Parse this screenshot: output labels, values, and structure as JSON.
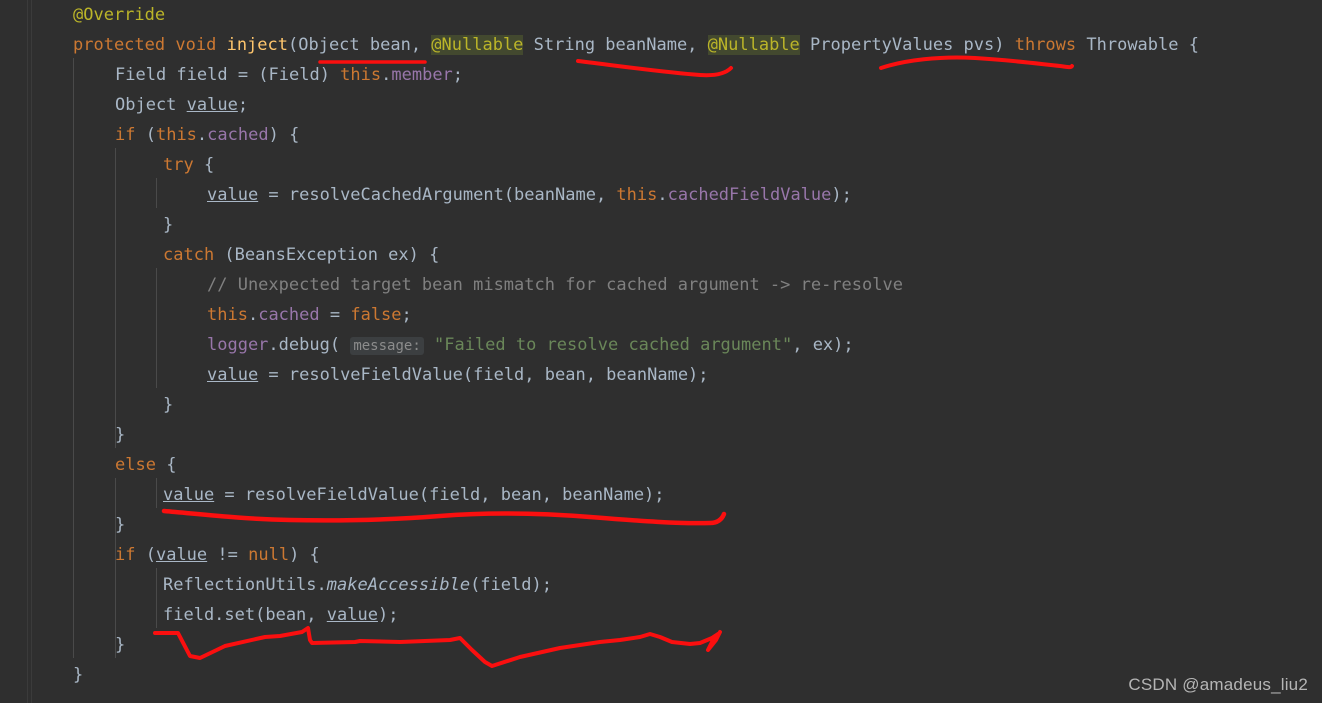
{
  "editor": {
    "background": "#2f2f2f",
    "gutter_background": "#2f2f2f",
    "default_text_color": "#a9b7c6",
    "annotation_color": "#fa0f0f"
  },
  "watermark": {
    "text": "CSDN @amadeus_liu2"
  },
  "code": {
    "language": "java",
    "lines": [
      {
        "indent": 0,
        "text": "@Override"
      },
      {
        "indent": 0,
        "text": "protected void inject(Object bean, @Nullable String beanName, @Nullable PropertyValues pvs) throws Throwable {"
      },
      {
        "indent": 4,
        "text": "Field field = (Field) this.member;"
      },
      {
        "indent": 4,
        "text": "Object value;"
      },
      {
        "indent": 4,
        "text": "if (this.cached) {"
      },
      {
        "indent": 8,
        "text": "try {"
      },
      {
        "indent": 12,
        "text": "value = resolveCachedArgument(beanName, this.cachedFieldValue);"
      },
      {
        "indent": 8,
        "text": "}"
      },
      {
        "indent": 8,
        "text": "catch (BeansException ex) {"
      },
      {
        "indent": 12,
        "text": "// Unexpected target bean mismatch for cached argument -> re-resolve"
      },
      {
        "indent": 12,
        "text": "this.cached = false;"
      },
      {
        "indent": 12,
        "text": "logger.debug( message: \"Failed to resolve cached argument\", ex);"
      },
      {
        "indent": 12,
        "text": "value = resolveFieldValue(field, bean, beanName);"
      },
      {
        "indent": 8,
        "text": "}"
      },
      {
        "indent": 4,
        "text": "}"
      },
      {
        "indent": 4,
        "text": "else {"
      },
      {
        "indent": 8,
        "text": "value = resolveFieldValue(field, bean, beanName);"
      },
      {
        "indent": 4,
        "text": "}"
      },
      {
        "indent": 4,
        "text": "if (value != null) {"
      },
      {
        "indent": 8,
        "text": "ReflectionUtils.makeAccessible(field);"
      },
      {
        "indent": 8,
        "text": "field.set(bean, value);"
      },
      {
        "indent": 4,
        "text": "}"
      },
      {
        "indent": 0,
        "text": "}"
      }
    ],
    "inlay_hints": [
      {
        "label": "message:",
        "line": 11
      }
    ],
    "tokens": {
      "annotation_override": "@Override",
      "keyword_protected": "protected",
      "keyword_void": "void",
      "method_inject": "inject",
      "annotation_nullable": "@Nullable",
      "keyword_throws": "throws",
      "keyword_this": "this",
      "keyword_if": "if",
      "keyword_else": "else",
      "keyword_try": "try",
      "keyword_catch": "catch",
      "keyword_false": "false",
      "keyword_null": "null",
      "string_failed": "\"Failed to resolve cached argument\"",
      "comment_line": "// Unexpected target bean mismatch for cached argument -> re-resolve"
    },
    "colors": {
      "annotation": "#bbb529",
      "keyword": "#cc7832",
      "method": "#ffc66d",
      "field": "#9876aa",
      "string": "#6a8759",
      "comment": "#808080",
      "identifier": "#a9b7c6",
      "nullable_highlight_bg": "#43492f",
      "inlay_hint_bg": "#3c3f41",
      "inlay_hint_fg": "#8c8c8c"
    }
  },
  "annotations": {
    "description": "Hand-drawn red marker strokes highlighting code regions",
    "strokes": [
      {
        "name": "underline-object-bean",
        "target": "Object bean"
      },
      {
        "name": "curve-string-beanname",
        "target": "String beanName,"
      },
      {
        "name": "curve-propertyvalues-pvs",
        "target": "PropertyValues pvs)"
      },
      {
        "name": "wave-resolve-field-value",
        "target": "value = resolveFieldValue(field, bean, beanName);"
      },
      {
        "name": "zigzag-field-set",
        "target": "field.set(bean, value);"
      }
    ]
  }
}
